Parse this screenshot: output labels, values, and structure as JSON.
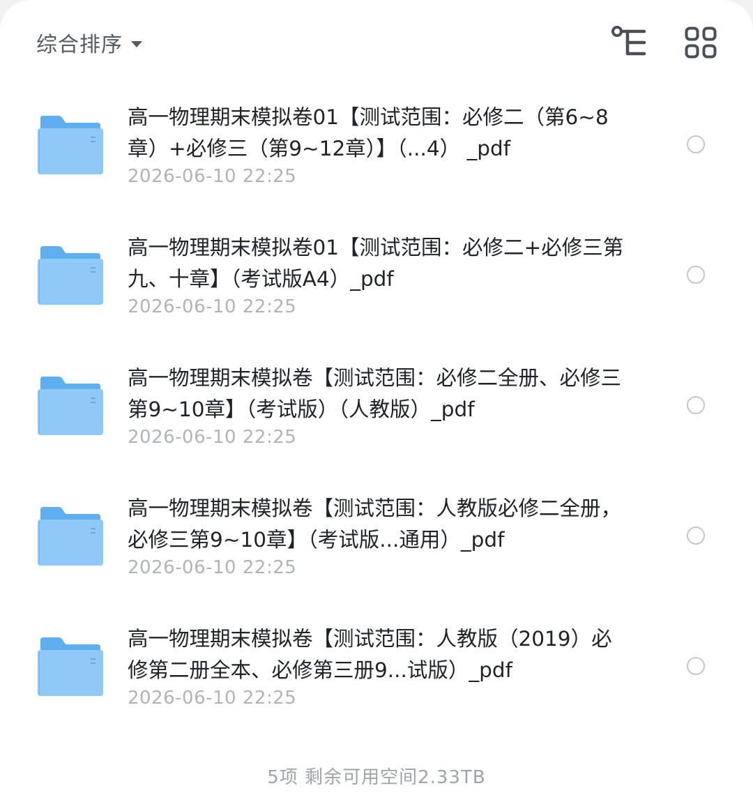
{
  "toolbar": {
    "sort_label": "综合排序",
    "icons": {
      "sort_caret": "caret-down-icon",
      "tree_view": "tree-view-icon",
      "grid_view": "grid-view-icon"
    }
  },
  "files": [
    {
      "icon": "folder-icon",
      "name": "高一物理期末模拟卷01【测试范围：必修二（第6~8章）+必修三（第9~12章）】（...4） _pdf",
      "date": "2026-06-10 22:25",
      "selected": false
    },
    {
      "icon": "folder-icon",
      "name": "高一物理期末模拟卷01【测试范围：必修二+必修三第九、十章】（考试版A4）_pdf",
      "date": "2026-06-10 22:25",
      "selected": false
    },
    {
      "icon": "folder-icon",
      "name": "高一物理期末模拟卷【测试范围：必修二全册、必修三第9~10章】（考试版）（人教版）_pdf",
      "date": "2026-06-10 22:25",
      "selected": false
    },
    {
      "icon": "folder-icon",
      "name": "高一物理期末模拟卷【测试范围：人教版必修二全册，必修三第9~10章】（考试版...通用）_pdf",
      "date": "2026-06-10 22:25",
      "selected": false
    },
    {
      "icon": "folder-icon",
      "name": "高一物理期末模拟卷【测试范围：人教版（2019）必修第二册全本、必修第三册9...试版）_pdf",
      "date": "2026-06-10 22:25",
      "selected": false
    }
  ],
  "footer": {
    "summary": "5项 剩余可用空间2.33TB"
  },
  "colors": {
    "folder_light": "#8ec9f7",
    "folder_dark": "#5faef0",
    "text_primary": "#1f2329",
    "text_secondary": "#b0b4ba",
    "icon": "#4a4f57"
  }
}
